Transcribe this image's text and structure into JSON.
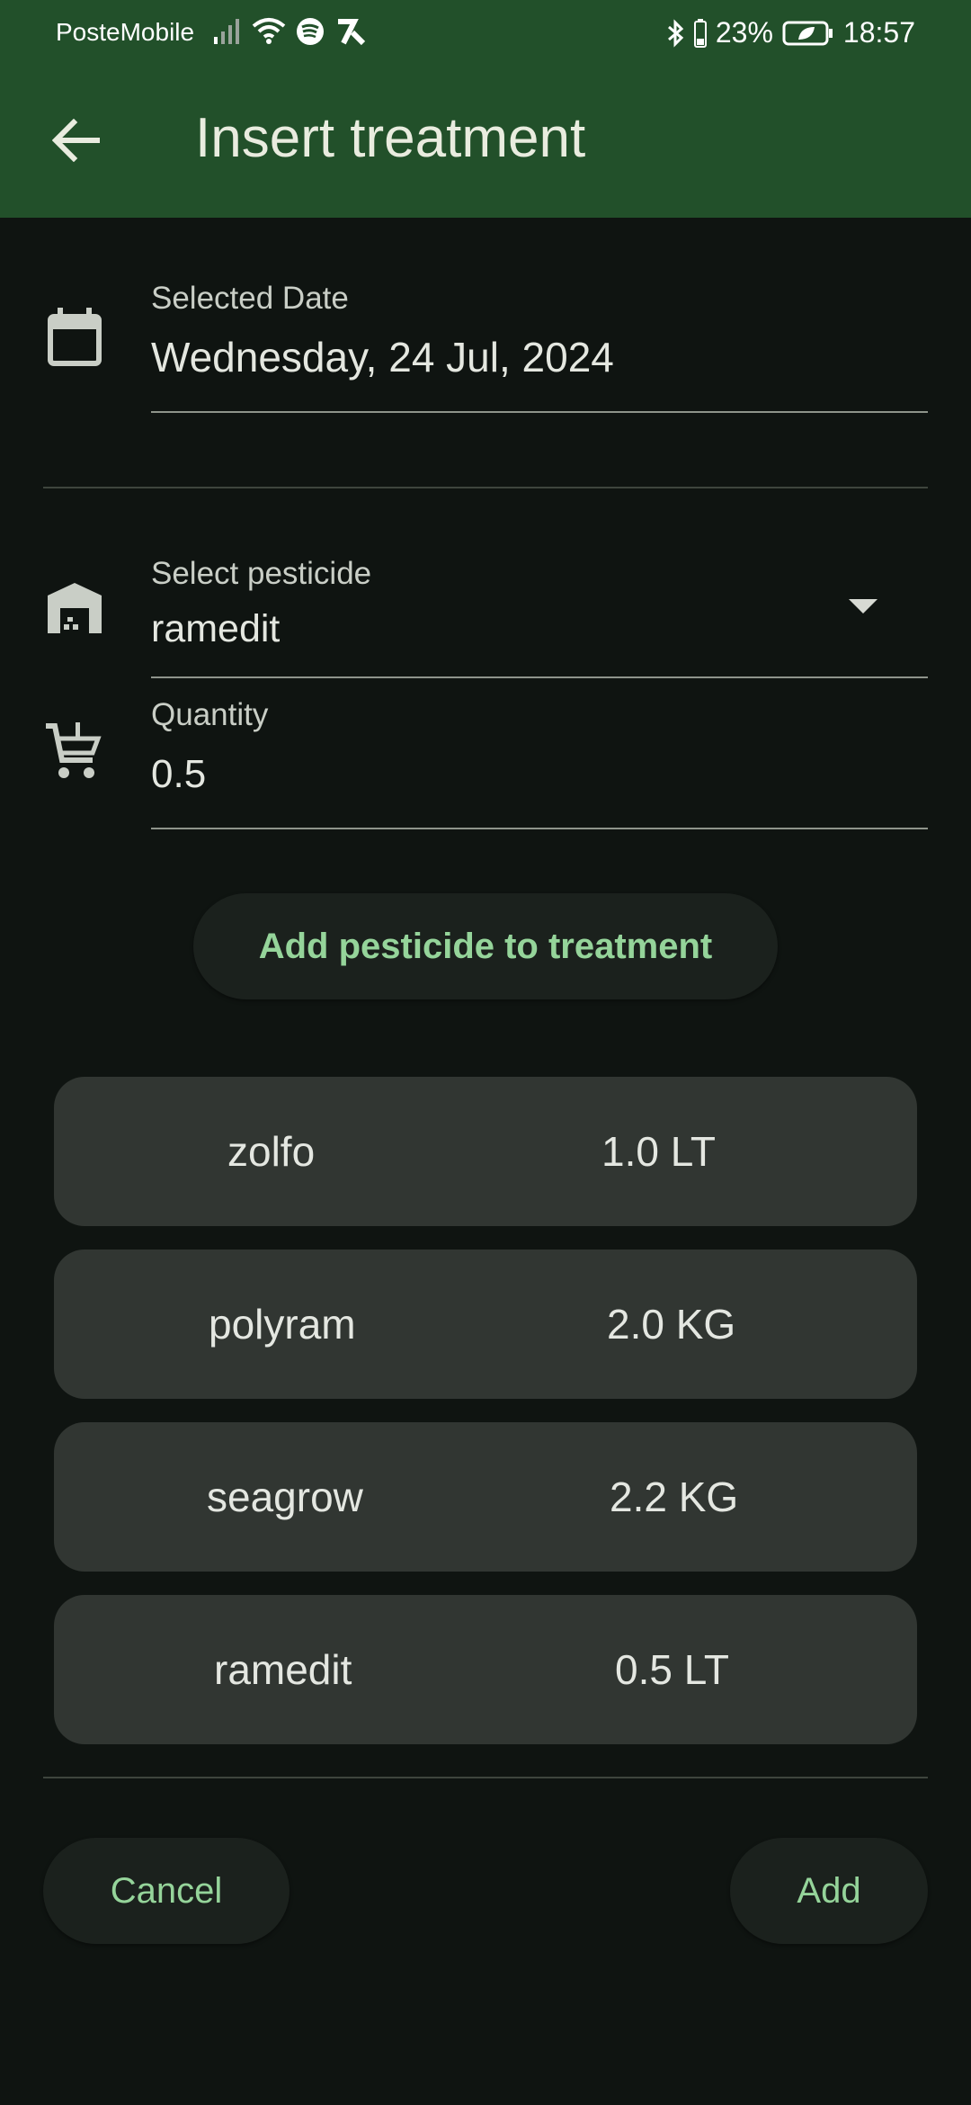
{
  "status_bar": {
    "carrier": "PosteMobile",
    "battery": "23%",
    "time": "18:57"
  },
  "app_bar": {
    "title": "Insert treatment"
  },
  "date_field": {
    "label": "Selected Date",
    "value": "Wednesday, 24 Jul, 2024"
  },
  "pesticide_field": {
    "label": "Select pesticide",
    "value": "ramedit"
  },
  "quantity_field": {
    "label": "Quantity",
    "value": "0.5"
  },
  "add_pesticide_button": "Add pesticide to treatment",
  "items": [
    {
      "name": "zolfo",
      "quantity": "1.0 LT"
    },
    {
      "name": "polyram",
      "quantity": "2.0 KG"
    },
    {
      "name": "seagrow",
      "quantity": "2.2 KG"
    },
    {
      "name": "ramedit",
      "quantity": "0.5 LT"
    }
  ],
  "footer": {
    "cancel_label": "Cancel",
    "add_label": "Add"
  },
  "colors": {
    "app_bar": "#22502a",
    "background": "#0f1411",
    "accent": "#95d49a",
    "card": "#313632"
  }
}
